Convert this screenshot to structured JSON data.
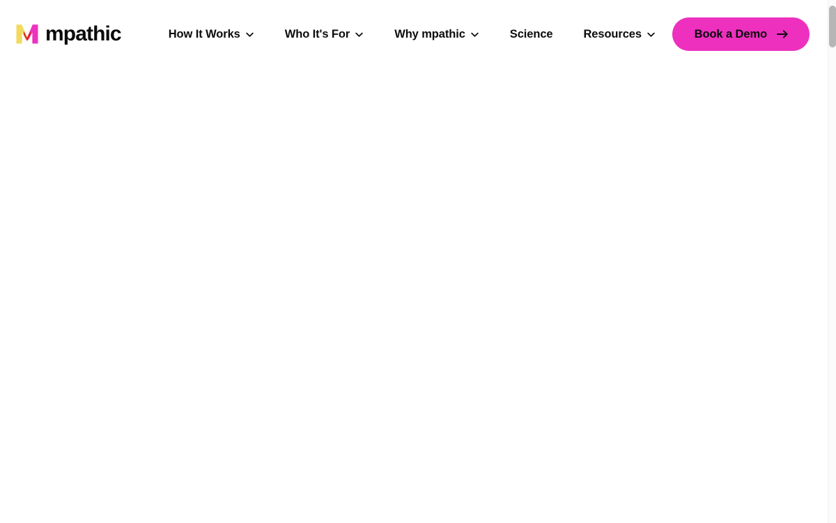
{
  "site": {
    "brand": {
      "logo_icon": "mpathic-m-logo-icon",
      "wordmark": "mpathic",
      "colors": {
        "logo_yellow": "#f2da5e",
        "logo_magenta": "#ed33be",
        "logo_red": "#e02020"
      }
    },
    "nav": {
      "items": [
        {
          "label": "How It Works",
          "has_dropdown": true,
          "icon": "chevron-down-icon"
        },
        {
          "label": "Who It's For",
          "has_dropdown": true,
          "icon": "chevron-down-icon"
        },
        {
          "label": "Why mpathic",
          "has_dropdown": true,
          "icon": "chevron-down-icon"
        },
        {
          "label": "Science",
          "has_dropdown": false,
          "icon": ""
        },
        {
          "label": "Resources",
          "has_dropdown": true,
          "icon": "chevron-down-icon"
        }
      ]
    },
    "cta": {
      "label": "Book a Demo",
      "icon": "arrow-right-icon",
      "background_color": "#ed30be",
      "text_color": "#0a0a0a"
    },
    "body": {
      "content": ""
    },
    "scrollbar": {
      "orientation": "vertical",
      "thumb_color": "#b6b6b6",
      "track_color": "#fbfbfb"
    }
  }
}
